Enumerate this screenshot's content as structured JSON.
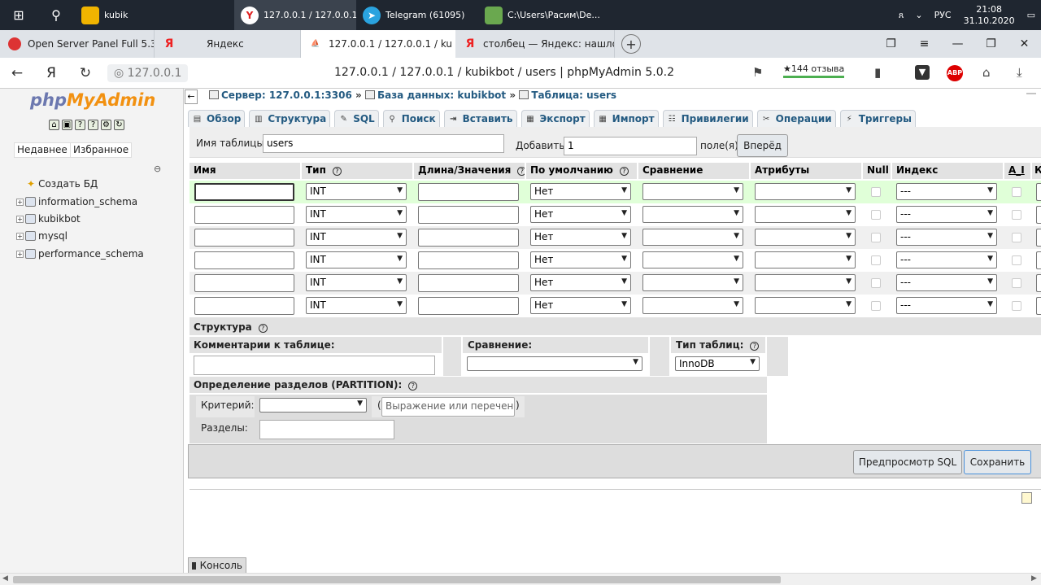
{
  "taskbar": {
    "apps": [
      {
        "label": "kubik",
        "icon": "folder-icon",
        "color": "#f0b400"
      },
      {
        "label": "127.0.0.1 / 127.0.0.1...",
        "icon": "yandex-browser-icon",
        "color": "#e02020",
        "active": true
      },
      {
        "label": "Telegram (61095)",
        "icon": "telegram-icon",
        "color": "#2aa3df",
        "badge": "95"
      },
      {
        "label": "C:\\Users\\Расим\\De...",
        "icon": "notepad-icon",
        "color": "#6aa84f"
      }
    ],
    "lang": "РУС",
    "time": "21:08",
    "date": "31.10.2020"
  },
  "browser_tabs": [
    {
      "label": "Open Server Panel Full 5.3.",
      "fav_color": "#d33"
    },
    {
      "label": "Яндекс",
      "fav": "Я",
      "fav_color": "#e22"
    },
    {
      "label": "127.0.0.1 / 127.0.0.1 / ku",
      "fav": "pma",
      "fav_color": "#f29111",
      "active": true
    },
    {
      "label": "столбец — Яндекс: нашло",
      "fav": "Я",
      "fav_color": "#e22"
    }
  ],
  "address": {
    "host": "127.0.0.1",
    "title": "127.0.0.1 / 127.0.0.1 / kubikbot / users | phpMyAdmin 5.0.2",
    "rating": "★144 отзыва",
    "adblock": "ABP"
  },
  "nav": {
    "logo_php": "php",
    "logo_my": "MyAdmin",
    "tab_recent": "Недавнее",
    "tab_fav": "Избранное",
    "create_db": "Создать БД",
    "databases": [
      "information_schema",
      "kubikbot",
      "mysql",
      "performance_schema"
    ]
  },
  "breadcrumb": {
    "server": "Сервер: 127.0.0.1:3306",
    "database": "База данных: kubikbot",
    "table": "Таблица: users"
  },
  "menu": [
    "Обзор",
    "Структура",
    "SQL",
    "Поиск",
    "Вставить",
    "Экспорт",
    "Импорт",
    "Привилегии",
    "Операции",
    "Триггеры"
  ],
  "form": {
    "table_name_label": "Имя таблицы:",
    "table_name": "users",
    "add_label": "Добавить",
    "add_count": "1",
    "fields_label": "поле(я)",
    "go_label": "Вперёд"
  },
  "columns": {
    "name": "Имя",
    "type": "Тип",
    "length": "Длина/Значения",
    "default": "По умолчанию",
    "collation": "Сравнение",
    "attributes": "Атрибуты",
    "null": "Null",
    "index": "Индекс",
    "ai": "A_I",
    "extra": "К"
  },
  "rows": [
    {
      "type": "INT",
      "default": "Нет",
      "index": "---"
    },
    {
      "type": "INT",
      "default": "Нет",
      "index": "---"
    },
    {
      "type": "INT",
      "default": "Нет",
      "index": "---"
    },
    {
      "type": "INT",
      "default": "Нет",
      "index": "---"
    },
    {
      "type": "INT",
      "default": "Нет",
      "index": "---"
    },
    {
      "type": "INT",
      "default": "Нет",
      "index": "---"
    }
  ],
  "structure": {
    "title": "Структура",
    "comment_label": "Комментарии к таблице:",
    "collation_label": "Сравнение:",
    "engine_label": "Тип таблиц:",
    "engine": "InnoDB"
  },
  "partition": {
    "title": "Определение разделов (PARTITION):",
    "criteria_label": "Критерий:",
    "expr_placeholder": "Выражение или перечень с",
    "open_paren": "(",
    "close_paren": ")",
    "parts_label": "Разделы:"
  },
  "buttons": {
    "preview_sql": "Предпросмотр SQL",
    "save": "Сохранить"
  },
  "console": "Консоль"
}
